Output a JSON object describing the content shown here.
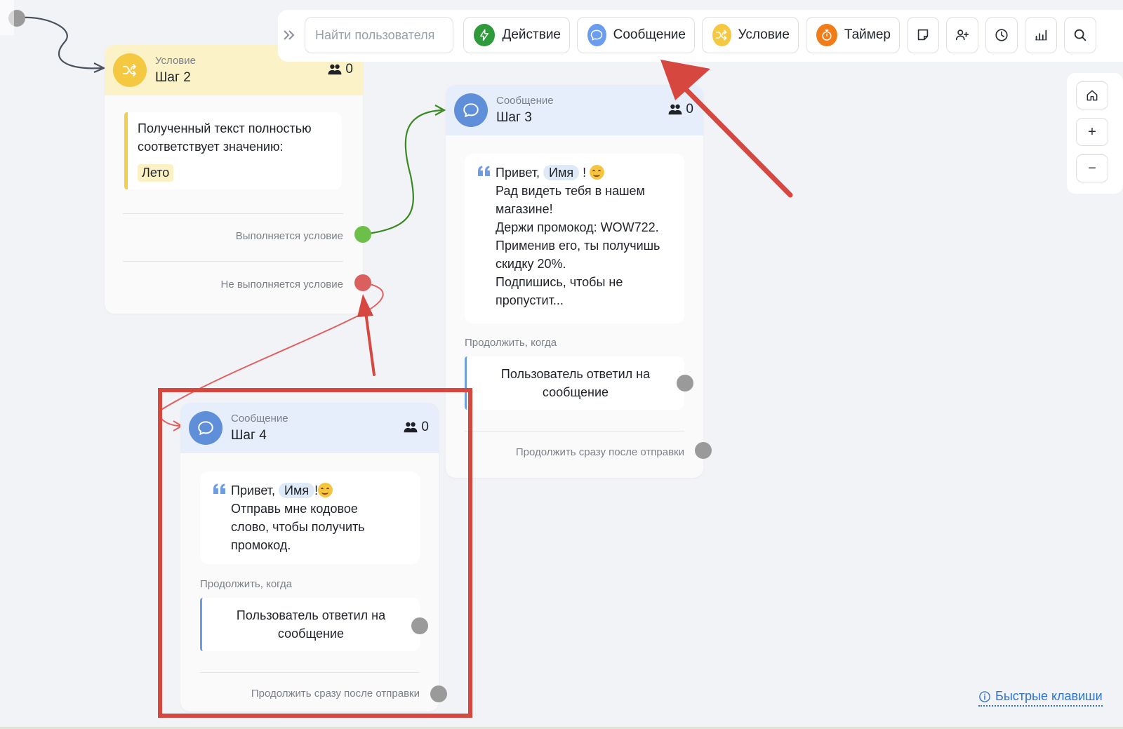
{
  "toolbar": {
    "search_placeholder": "Найти пользователя",
    "buttons": [
      {
        "label": "Действие",
        "icon": "lightning-icon",
        "color": "#2e9a3a"
      },
      {
        "label": "Сообщение",
        "icon": "chat-bubble-icon",
        "color": "#6a9cf0"
      },
      {
        "label": "Условие",
        "icon": "shuffle-icon",
        "color": "#f5c842"
      },
      {
        "label": "Таймер",
        "icon": "stopwatch-icon",
        "color": "#f07c1a"
      }
    ],
    "icon_buttons": [
      "note-icon",
      "add-user-icon",
      "history-icon",
      "stats-icon",
      "search-icon"
    ]
  },
  "zoom": {
    "home_icon": "home-icon",
    "zoom_in": "+",
    "zoom_out": "−"
  },
  "nodes": {
    "step2": {
      "type": "Условие",
      "title": "Шаг 2",
      "count": "0",
      "condition_text": "Полученный текст полностью соответствует значению:",
      "value": "Лето",
      "exit_yes": "Выполняется условие",
      "exit_no": "Не выполняется условие",
      "header_color": "#fbf3c7",
      "icon_color": "#f5c842"
    },
    "step3": {
      "type": "Сообщение",
      "title": "Шаг 3",
      "count": "0",
      "greeting": "Привет,",
      "name_chip": "Имя",
      "bang": "!",
      "lines": [
        "Рад видеть тебя в нашем",
        "магазине!",
        "Держи промокод: WOW722.",
        "Применив его, ты получишь",
        "скидку 20%.",
        "Подпишись, чтобы не",
        "пропустит..."
      ],
      "continue_title": "Продолжить, когда",
      "trigger": "Пользователь ответил на сообщение",
      "continue_immediately": "Продолжить сразу после отправки",
      "header_color": "#e6eefb",
      "icon_color": "#5f8fd8"
    },
    "step4": {
      "type": "Сообщение",
      "title": "Шаг 4",
      "count": "0",
      "greeting": "Привет,",
      "name_chip": "Имя",
      "bang": "!",
      "lines": [
        "Отправь мне кодовое",
        "слово, чтобы получить",
        "промокод."
      ],
      "continue_title": "Продолжить, когда",
      "trigger": "Пользователь ответил на сообщение",
      "continue_immediately": "Продолжить сразу после отправки",
      "header_color": "#e6eefb",
      "icon_color": "#5f8fd8"
    }
  },
  "footer": {
    "shortcuts": "Быстрые клавиши"
  },
  "colors": {
    "port_yes": "#6cc04a",
    "port_no": "#d9605e",
    "port_neutral": "#9a9a9a",
    "annotation": "#d6473f",
    "link_green": "#3a8a22",
    "link_red": "#e06060",
    "link_gray": "#4a525e"
  }
}
